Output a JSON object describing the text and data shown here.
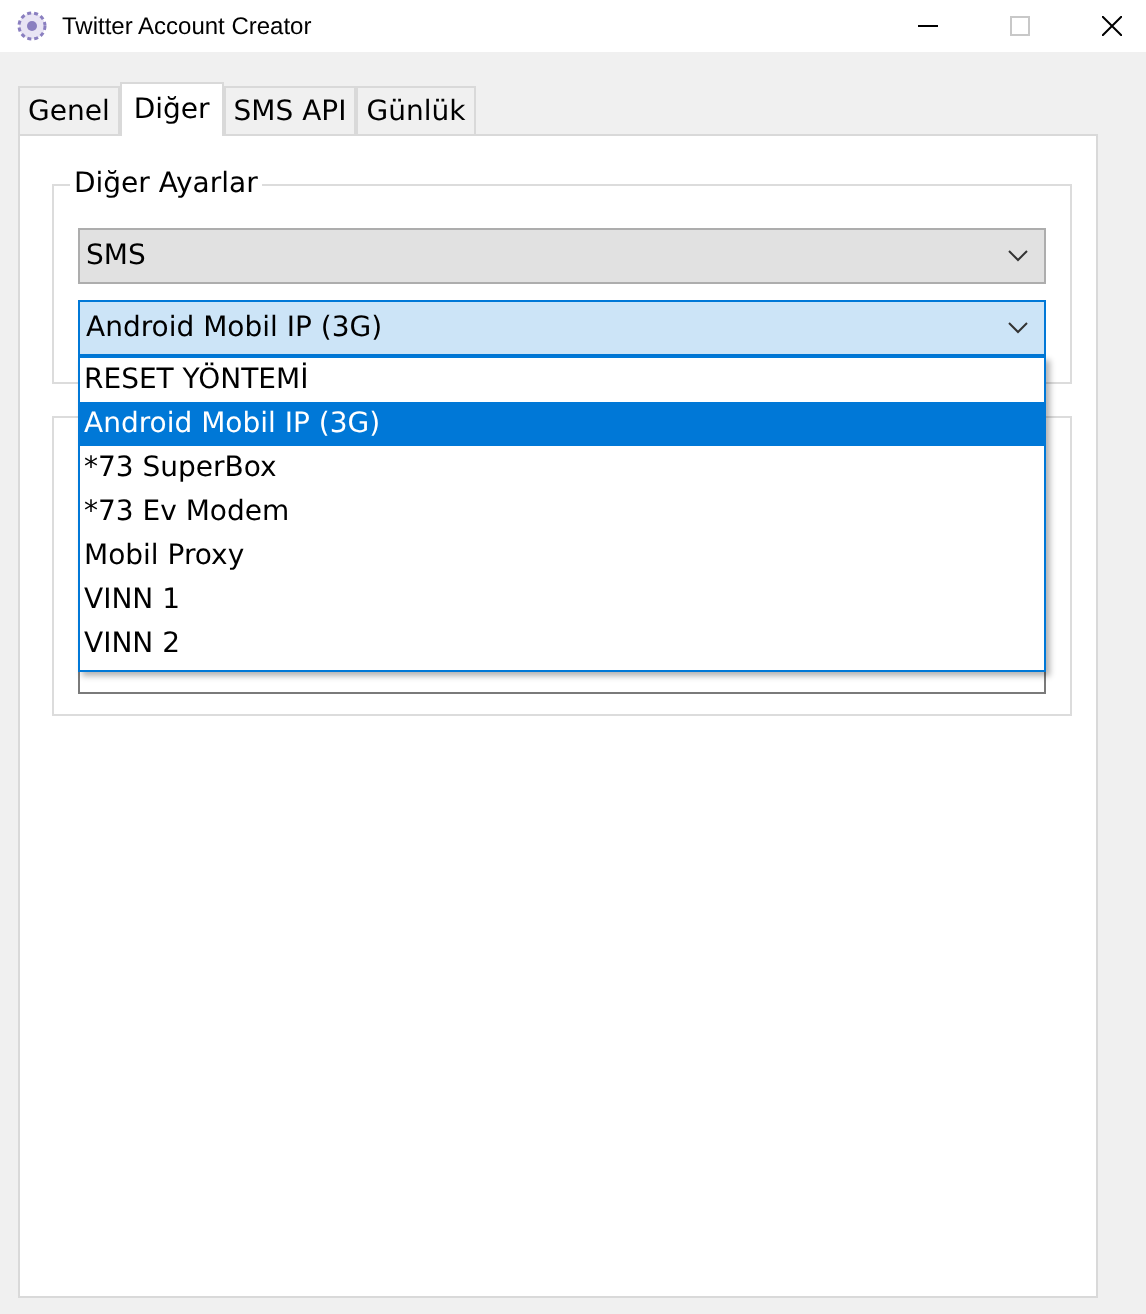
{
  "window": {
    "title": "Twitter Account Creator",
    "maximize_disabled": true
  },
  "tabs": [
    {
      "label": "Genel",
      "selected": false
    },
    {
      "label": "Diğer",
      "selected": true
    },
    {
      "label": "SMS API",
      "selected": false
    },
    {
      "label": "Günlük",
      "selected": false
    }
  ],
  "group": {
    "title": "Diğer Ayarlar"
  },
  "sms_combo": {
    "value": "SMS"
  },
  "reset_combo": {
    "value": "Android Mobil IP (3G)",
    "expanded": true,
    "options": [
      {
        "label": "RESET YÖNTEMİ",
        "selected": false
      },
      {
        "label": "Android Mobil IP (3G)",
        "selected": true
      },
      {
        "label": "*73 SuperBox",
        "selected": false
      },
      {
        "label": "*73 Ev Modem",
        "selected": false
      },
      {
        "label": "Mobil Proxy",
        "selected": false
      },
      {
        "label": "VINN 1",
        "selected": false
      },
      {
        "label": "VINN 2",
        "selected": false
      }
    ]
  }
}
